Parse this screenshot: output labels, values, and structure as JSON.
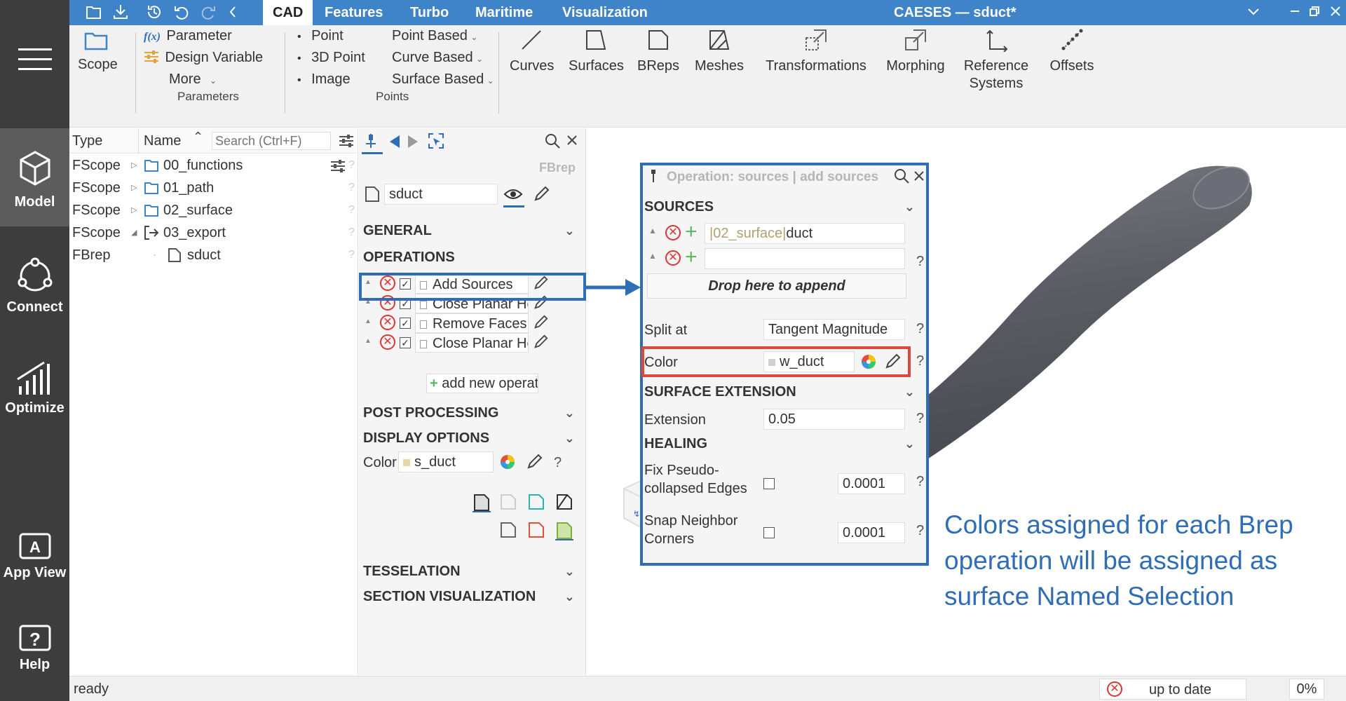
{
  "app": {
    "title": "CAESES — sduct*"
  },
  "menu_tabs": [
    {
      "label": "CAD"
    },
    {
      "label": "Features"
    },
    {
      "label": "Turbo"
    },
    {
      "label": "Maritime"
    },
    {
      "label": "Visualization"
    }
  ],
  "rail": {
    "model": "Model",
    "connect": "Connect",
    "optimize": "Optimize",
    "app_view": "App View",
    "help": "Help"
  },
  "ribbon": {
    "scope": "Scope",
    "parameter": "Parameter",
    "fx": "f(x)",
    "design_variable": "Design Variable",
    "more": "More",
    "group_parameters": "Parameters",
    "point": "Point",
    "point_3d": "3D Point",
    "image": "Image",
    "point_based": "Point Based",
    "curve_based": "Curve Based",
    "surface_based": "Surface Based",
    "group_points": "Points",
    "curves": "Curves",
    "surfaces": "Surfaces",
    "breps": "BReps",
    "meshes": "Meshes",
    "transformations": "Transformations",
    "morphing": "Morphing",
    "reference_systems_1": "Reference",
    "reference_systems_2": "Systems",
    "offsets": "Offsets"
  },
  "tree": {
    "col_type": "Type",
    "col_name": "Name",
    "search_placeholder": "Search (Ctrl+F)",
    "rows": [
      {
        "type": "FScope",
        "name": "00_functions"
      },
      {
        "type": "FScope",
        "name": "01_path"
      },
      {
        "type": "FScope",
        "name": "02_surface"
      },
      {
        "type": "FScope",
        "name": "03_export"
      },
      {
        "type": "FBrep",
        "name": "sduct"
      }
    ]
  },
  "props": {
    "kind": "FBrep",
    "name": "sduct",
    "sections": {
      "general": "GENERAL",
      "operations": "OPERATIONS",
      "post_processing": "POST PROCESSING",
      "display_options": "DISPLAY OPTIONS",
      "tesselation": "TESSELATION",
      "section_visualization": "SECTION VISUALIZATION"
    },
    "operations": [
      {
        "label": "Add Sources"
      },
      {
        "label": "Close Planar Holes"
      },
      {
        "label": "Remove Faces"
      },
      {
        "label": "Close Planar Holes"
      }
    ],
    "add_new_operation": "add new operation",
    "color_label": "Color",
    "color_value": "s_duct",
    "help": "?"
  },
  "op_panel": {
    "title": "Operation: sources | add sources",
    "sources_header": "SOURCES",
    "source_1_path": "|02_surface|",
    "source_1_name": "duct",
    "drop_here": "Drop here to append",
    "split_at_label": "Split at",
    "split_at_value": "Tangent Magnitude",
    "color_label": "Color",
    "color_value": "w_duct",
    "surface_extension_header": "SURFACE EXTENSION",
    "extension_label": "Extension",
    "extension_value": "0.05",
    "healing_header": "HEALING",
    "fix_pseudo_1": "Fix Pseudo-",
    "fix_pseudo_2": "collapsed Edges",
    "fix_pseudo_value": "0.0001",
    "snap_1": "Snap Neighbor",
    "snap_2": "Corners",
    "snap_value": "0.0001",
    "help": "?"
  },
  "annotation": {
    "line1": "Colors assigned for each Brep",
    "line2": "operation will be assigned as",
    "line3": "surface Named Selection",
    "color": "#2f6db5"
  },
  "status": {
    "left": "ready",
    "state": "up to date",
    "progress": "0%"
  },
  "colors": {
    "accent": "#3f83c8",
    "highlight_blue": "#2f6db5",
    "highlight_red": "#d94a3d",
    "duct": "#5d5f68"
  }
}
